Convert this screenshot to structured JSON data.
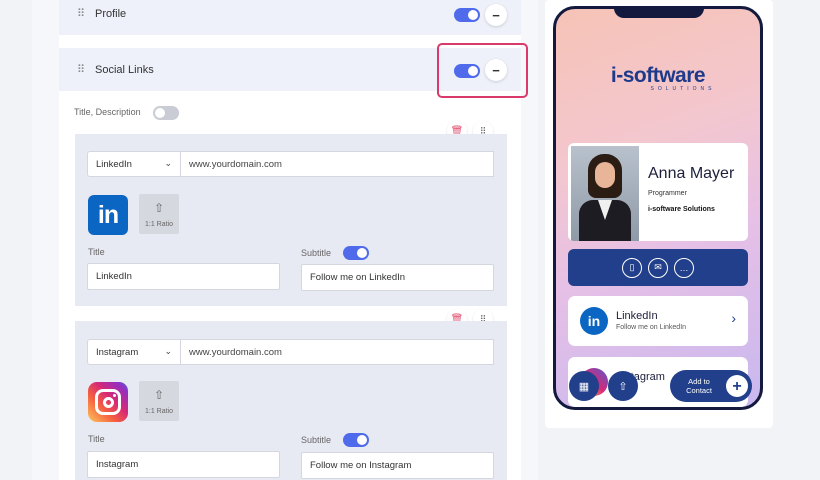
{
  "sections": {
    "profile": {
      "title": "Profile"
    },
    "social_links": {
      "title": "Social Links"
    }
  },
  "title_description_label": "Title, Description",
  "links": [
    {
      "platform": "LinkedIn",
      "url_placeholder": "www.yourdomain.com",
      "upload_label": "1:1 Ratio",
      "title_label": "Title",
      "title_value": "LinkedIn",
      "subtitle_label": "Subtitle",
      "subtitle_value": "Follow me on LinkedIn",
      "logo_text": "in"
    },
    {
      "platform": "Instagram",
      "url_placeholder": "www.yourdomain.com",
      "upload_label": "1:1 Ratio",
      "title_label": "Title",
      "title_value": "Instagram",
      "subtitle_label": "Subtitle",
      "subtitle_value": "Follow me on Instagram"
    }
  ],
  "preview": {
    "brand": "i-software",
    "brand_sub": "SOLUTIONS",
    "name": "Anna Mayer",
    "role": "Programmer",
    "company": "i-software Solutions",
    "social_cards": [
      {
        "title": "LinkedIn",
        "subtitle": "Follow me on LinkedIn",
        "logo_text": "in"
      },
      {
        "title": "Instagram",
        "subtitle": ""
      }
    ],
    "add_contact_label": "Add to Contact"
  },
  "icons": {
    "drag": "drag-handle-icon",
    "minus": "minus-icon",
    "delete": "trash-icon",
    "move": "move-icon",
    "upload": "upload-icon",
    "phone": "phone-icon",
    "mail": "mail-icon",
    "chat": "chat-icon",
    "chevron": "chevron-right-icon",
    "qr": "qr-code-icon",
    "share": "share-icon",
    "plus": "plus-icon"
  },
  "colors": {
    "accent": "#4f6bec",
    "brand_navy": "#213f8a",
    "highlight_border": "#d93a6b",
    "linkedin": "#0a66c2"
  },
  "toggles": {
    "profile": true,
    "social_links": true,
    "title_description": false,
    "linkedin_subtitle": true,
    "instagram_subtitle": true
  }
}
